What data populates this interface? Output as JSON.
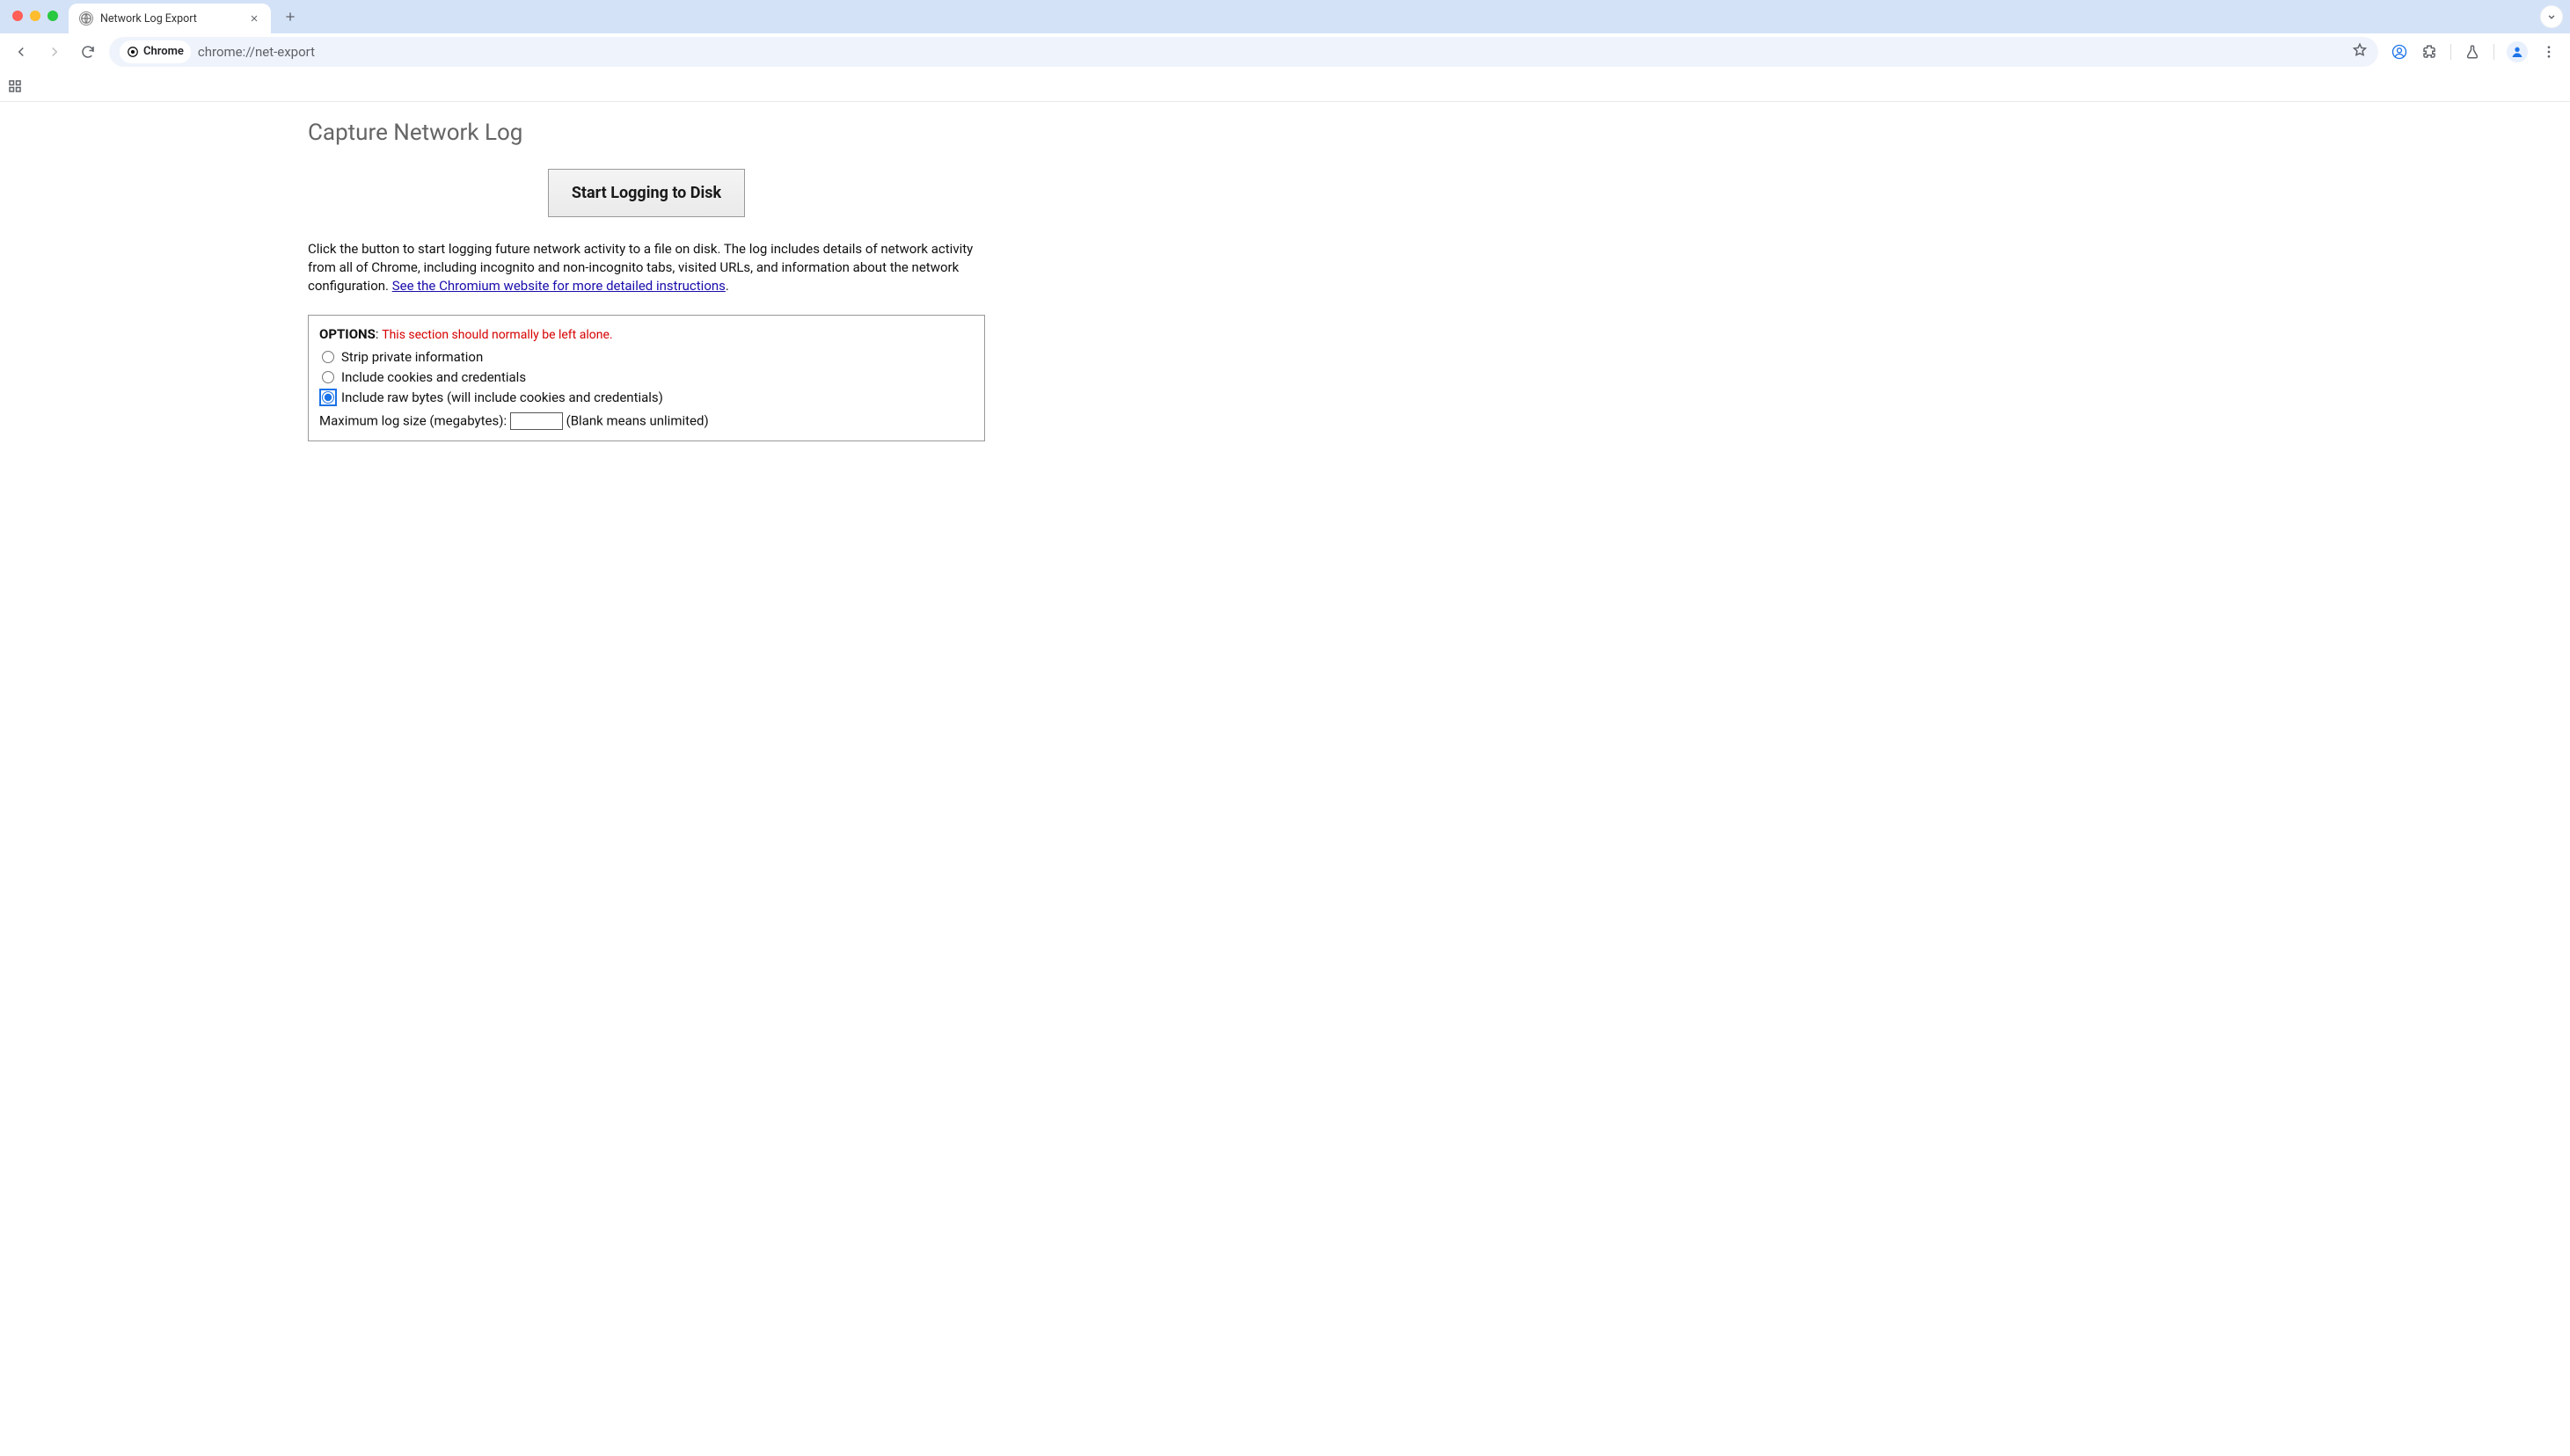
{
  "browser": {
    "tab_title": "Network Log Export",
    "omni_chip": "Chrome",
    "url": "chrome://net-export"
  },
  "page": {
    "heading": "Capture Network Log",
    "start_button": "Start Logging to Disk",
    "description_pre": "Click the button to start logging future network activity to a file on disk. The log includes details of network activity from all of Chrome, including incognito and non-incognito tabs, visited URLs, and information about the network configuration. ",
    "description_link": "See the Chromium website for more detailed instructions",
    "description_post": "."
  },
  "options": {
    "label": "OPTIONS",
    "colon": ":",
    "warning": "This section should normally be left alone.",
    "radios": [
      {
        "label": "Strip private information",
        "checked": false
      },
      {
        "label": "Include cookies and credentials",
        "checked": false
      },
      {
        "label": "Include raw bytes (will include cookies and credentials)",
        "checked": true
      }
    ],
    "max_size_label": "Maximum log size (megabytes): ",
    "max_size_value": "",
    "max_size_hint": " (Blank means unlimited)"
  }
}
